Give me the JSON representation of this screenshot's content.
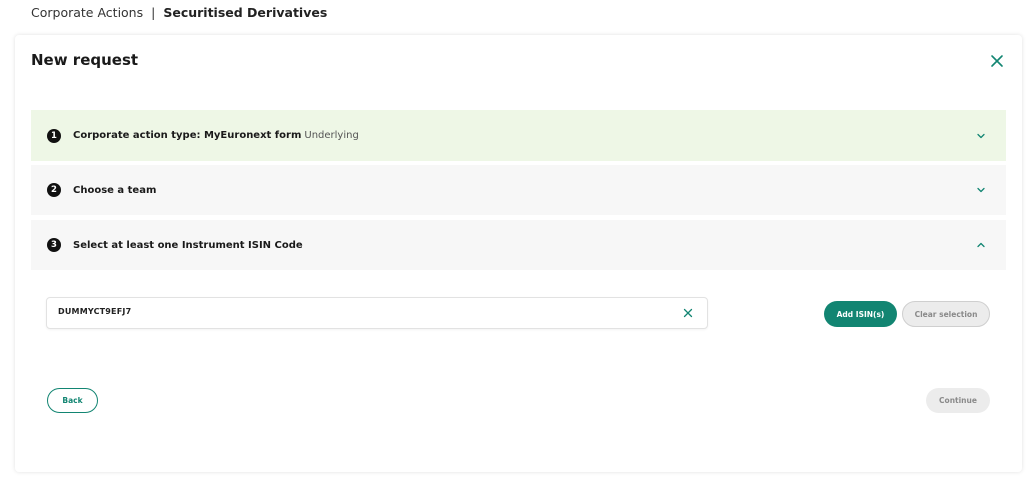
{
  "breadcrumb": {
    "parent": "Corporate Actions",
    "separator": "|",
    "current": "Securitised Derivatives"
  },
  "card": {
    "title": "New request",
    "close_icon": "close-icon"
  },
  "steps": [
    {
      "number": "1",
      "label": "Corporate action type: MyEuronext form",
      "sublabel": "Underlying",
      "state": "collapsed",
      "chevron": "chevron-down-icon"
    },
    {
      "number": "2",
      "label": "Choose a team",
      "sublabel": "",
      "state": "collapsed",
      "chevron": "chevron-down-icon"
    },
    {
      "number": "3",
      "label": "Select at least one Instrument ISIN Code",
      "sublabel": "",
      "state": "expanded",
      "chevron": "chevron-up-icon"
    }
  ],
  "isin": {
    "value": "DUMMYCT9EFJ7",
    "clear_icon": "close-icon"
  },
  "buttons": {
    "add": "Add ISIN(s)",
    "clear": "Clear selection",
    "back": "Back",
    "continue": "Continue"
  },
  "colors": {
    "accent": "#128572",
    "step_active_bg": "#eef7e6",
    "step_bg": "#f7f7f7"
  }
}
